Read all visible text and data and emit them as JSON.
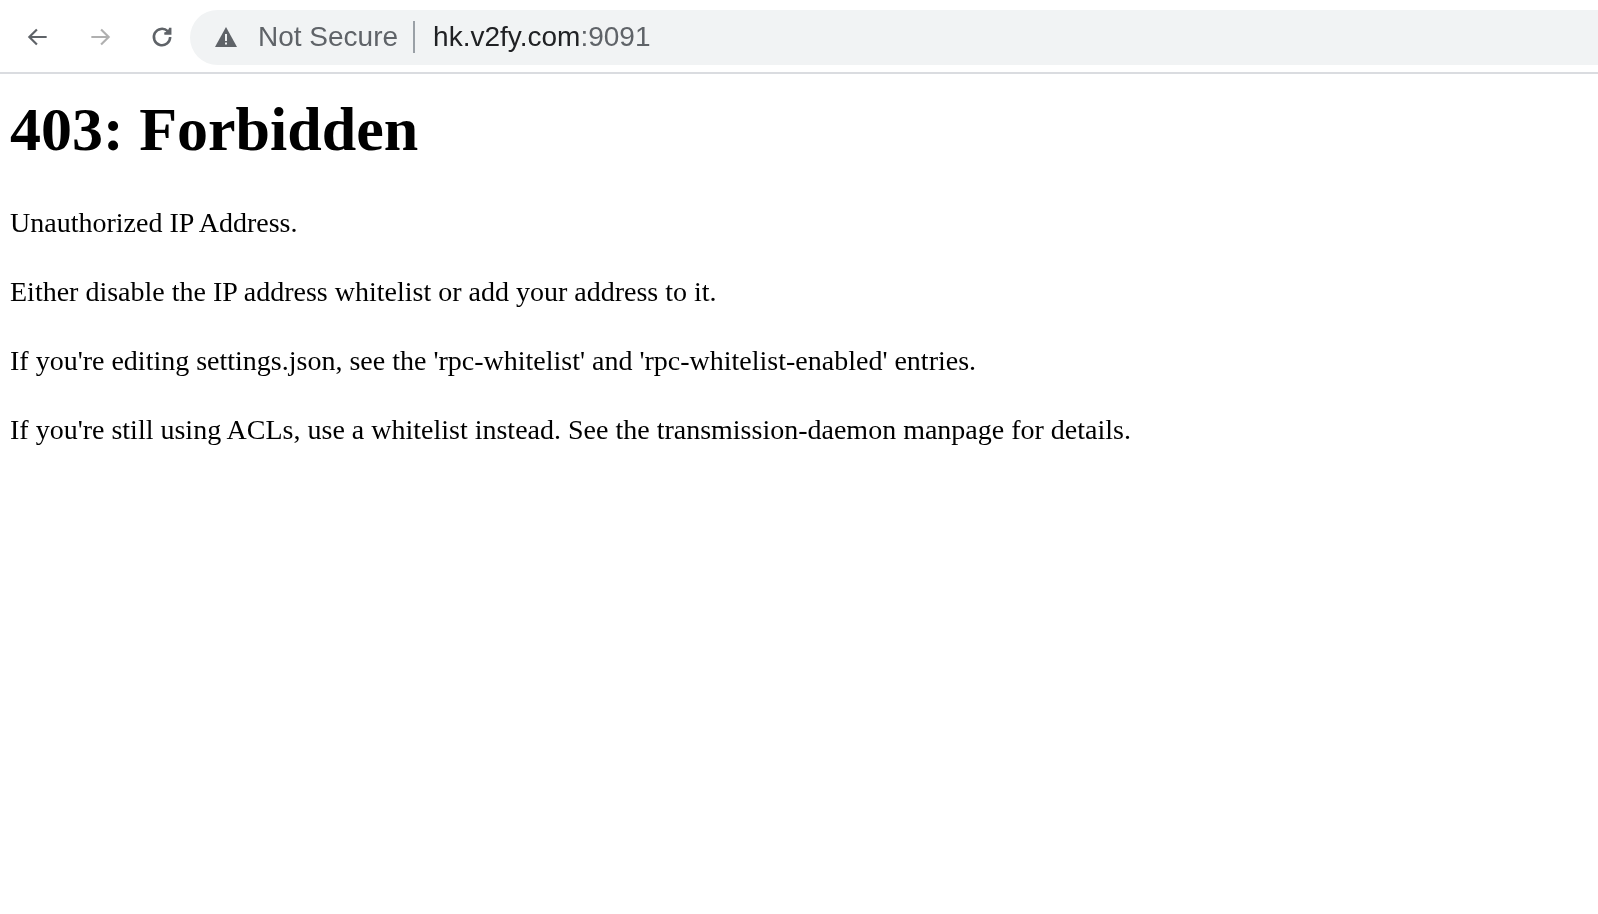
{
  "toolbar": {
    "back": {
      "disabled": false
    },
    "forward": {
      "disabled": true
    },
    "security_label": "Not Secure",
    "url": {
      "host": "hk.v2fy.com",
      "port": ":9091"
    }
  },
  "page": {
    "heading": "403: Forbidden",
    "paragraphs": [
      "Unauthorized IP Address.",
      "Either disable the IP address whitelist or add your address to it.",
      "If you're editing settings.json, see the 'rpc-whitelist' and 'rpc-whitelist-enabled' entries.",
      "If you're still using ACLs, use a whitelist instead. See the transmission-daemon manpage for details."
    ]
  }
}
